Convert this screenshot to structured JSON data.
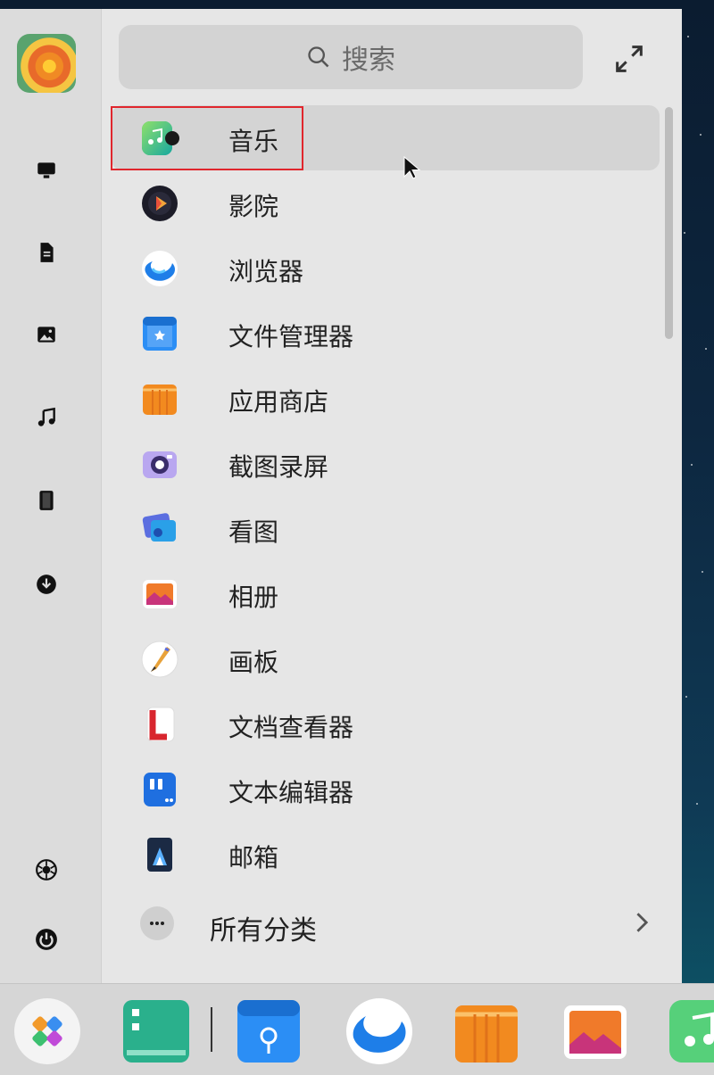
{
  "search": {
    "placeholder": "搜索"
  },
  "apps": [
    {
      "label": "音乐",
      "icon": "music-icon"
    },
    {
      "label": "影院",
      "icon": "movie-icon"
    },
    {
      "label": "浏览器",
      "icon": "browser-icon"
    },
    {
      "label": "文件管理器",
      "icon": "file-manager-icon"
    },
    {
      "label": "应用商店",
      "icon": "app-store-icon"
    },
    {
      "label": "截图录屏",
      "icon": "screenshot-icon"
    },
    {
      "label": "看图",
      "icon": "image-viewer-icon"
    },
    {
      "label": "相册",
      "icon": "album-icon"
    },
    {
      "label": "画板",
      "icon": "draw-icon"
    },
    {
      "label": "文档查看器",
      "icon": "document-viewer-icon"
    },
    {
      "label": "文本编辑器",
      "icon": "text-editor-icon"
    },
    {
      "label": "邮箱",
      "icon": "mail-icon"
    }
  ],
  "all_categories": {
    "label": "所有分类"
  },
  "sidebar": {
    "categories": [
      "monitor-icon",
      "document-icon",
      "picture-icon",
      "music-note-icon",
      "video-icon",
      "download-icon"
    ],
    "bottom": [
      "settings-icon",
      "power-icon"
    ]
  },
  "dock": {
    "items": [
      "launcher-icon",
      "multitasking-icon",
      "file-manager-icon",
      "browser-icon",
      "app-store-icon",
      "album-icon",
      "music-icon"
    ]
  },
  "colors": {
    "highlight": "#e0262d",
    "window_bg": "#e6e6e6",
    "sidebar_bg": "#dcdcdc"
  }
}
